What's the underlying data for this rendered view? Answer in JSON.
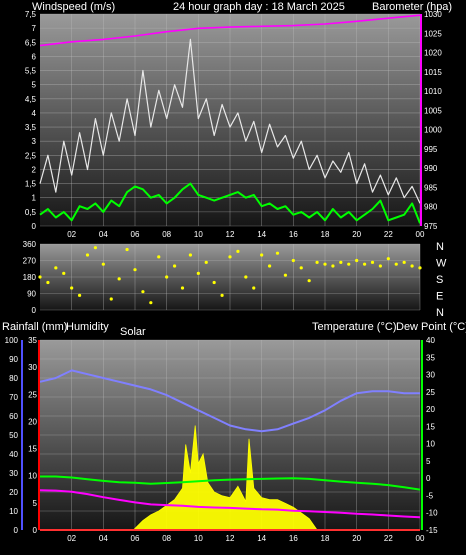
{
  "header": {
    "left_title": "Windspeed (m/s)",
    "center_title": "24 hour graph day : 18 March 2025",
    "right_title": "Barometer (hpa)"
  },
  "panel3_labels": {
    "rain": "Rainfall (mm)",
    "humidity": "Humidity",
    "solar": "Solar",
    "temperature": "Temperature (°C)",
    "dewpoint": "Dew Point (°C)"
  },
  "colors": {
    "background": "#000000",
    "plot_gradient_top": "#9a9a9a",
    "plot_gradient_bottom": "#161616",
    "wind_gust": "#e8e8e8",
    "wind_avg": "#00ff00",
    "barometer": "#ff00ff",
    "wind_dir": "#ffff00",
    "humidity_temp": "#8080ff",
    "rain": "#ff3030",
    "solar": "#ffff00",
    "temperature": "#00ff00",
    "dewpoint": "#ff00ff",
    "humidity_axis": "#5050ff",
    "rain_axis": "#ff0000"
  },
  "chart_data": [
    {
      "type": "line",
      "panel": "wind_barometer",
      "x_unit": "hour",
      "xlim": [
        0,
        24
      ],
      "x_ticks": [
        "02",
        "04",
        "06",
        "08",
        "10",
        "12",
        "14",
        "16",
        "18",
        "20",
        "22",
        "00"
      ],
      "left_axis": {
        "label": "Windspeed (m/s)",
        "ylim": [
          0,
          7.5
        ],
        "ticks": [
          "0",
          "0,5",
          "1",
          "1,5",
          "2",
          "2,5",
          "3",
          "3,5",
          "4",
          "4,5",
          "5",
          "5,5",
          "6",
          "6,5",
          "7",
          "7,5"
        ]
      },
      "right_axis": {
        "label": "Barometer (hpa)",
        "ylim": [
          975,
          1030
        ],
        "ticks": [
          "975",
          "980",
          "985",
          "990",
          "995",
          "1000",
          "1005",
          "1010",
          "1015",
          "1020",
          "1025",
          "1030"
        ]
      },
      "series": [
        {
          "name": "gust",
          "axis": "left",
          "x": [
            0,
            0.5,
            1,
            1.5,
            2,
            2.5,
            3,
            3.5,
            4,
            4.5,
            5,
            5.5,
            6,
            6.5,
            7,
            7.5,
            8,
            8.5,
            9,
            9.5,
            10,
            10.5,
            11,
            11.5,
            12,
            12.5,
            13,
            13.5,
            14,
            14.5,
            15,
            15.5,
            16,
            16.5,
            17,
            17.5,
            18,
            18.5,
            19,
            19.5,
            20,
            20.5,
            21,
            21.5,
            22,
            22.5,
            23,
            23.5,
            24
          ],
          "y": [
            1.5,
            2.5,
            1.2,
            3,
            1.8,
            3.3,
            2,
            3.8,
            2.5,
            4,
            3,
            4.5,
            3.2,
            5.5,
            3.5,
            4.8,
            3.8,
            5,
            4.2,
            6.6,
            3.8,
            4.5,
            3.2,
            4.3,
            3.5,
            4,
            3,
            3.7,
            2.6,
            3.6,
            2.8,
            3.2,
            2.4,
            3,
            2,
            2.5,
            1.7,
            2.3,
            1.9,
            2.6,
            1.5,
            2.2,
            1.2,
            1.8,
            1.1,
            1.7,
            1.0,
            1.4,
            0.8
          ]
        },
        {
          "name": "average",
          "axis": "left",
          "x": [
            0,
            0.5,
            1,
            1.5,
            2,
            2.5,
            3,
            3.5,
            4,
            4.5,
            5,
            5.5,
            6,
            6.5,
            7,
            7.5,
            8,
            8.5,
            9,
            9.5,
            10,
            10.5,
            11,
            11.5,
            12,
            12.5,
            13,
            13.5,
            14,
            14.5,
            15,
            15.5,
            16,
            16.5,
            17,
            17.5,
            18,
            18.5,
            19,
            19.5,
            20,
            20.5,
            21,
            21.5,
            22,
            22.5,
            23,
            23.5,
            24
          ],
          "y": [
            0.4,
            0.6,
            0.3,
            0.5,
            0.2,
            0.7,
            0.6,
            0.8,
            0.5,
            0.9,
            0.7,
            1.2,
            1.4,
            1.3,
            1.0,
            1.1,
            0.8,
            1.0,
            1.3,
            1.5,
            1.1,
            1.0,
            0.9,
            1.0,
            1.1,
            1.2,
            1.0,
            1.1,
            0.7,
            0.8,
            0.6,
            0.7,
            0.4,
            0.5,
            0.3,
            0.5,
            0.2,
            0.6,
            0.3,
            0.5,
            0.2,
            0.4,
            0.6,
            0.9,
            0.2,
            0.3,
            0.4,
            0.8,
            0.1
          ]
        },
        {
          "name": "barometer",
          "axis": "right",
          "x": [
            0,
            2,
            4,
            6,
            8,
            10,
            12,
            14,
            16,
            18,
            20,
            22,
            24
          ],
          "y": [
            1021.8,
            1022.8,
            1023.4,
            1024.3,
            1025.4,
            1026.3,
            1026.6,
            1026.8,
            1027.0,
            1027.4,
            1028.1,
            1028.9,
            1029.7
          ]
        }
      ]
    },
    {
      "type": "scatter",
      "panel": "wind_direction",
      "x_unit": "hour",
      "xlim": [
        0,
        24
      ],
      "left_axis": {
        "ylim": [
          0,
          360
        ],
        "ticks": [
          "0",
          "90",
          "180",
          "270",
          "360"
        ]
      },
      "right_labels": [
        "N",
        "W",
        "S",
        "E",
        "N"
      ],
      "series": [
        {
          "name": "direction",
          "x": [
            0,
            0.5,
            1,
            1.5,
            2,
            2.5,
            3,
            3.5,
            4,
            4.5,
            5,
            5.5,
            6,
            6.5,
            7,
            7.5,
            8,
            8.5,
            9,
            9.5,
            10,
            10.5,
            11,
            11.5,
            12,
            12.5,
            13,
            13.5,
            14,
            14.5,
            15,
            15.5,
            16,
            16.5,
            17,
            17.5,
            18,
            18.5,
            19,
            19.5,
            20,
            20.5,
            21,
            21.5,
            22,
            22.5,
            23,
            23.5,
            24
          ],
          "y": [
            180,
            150,
            230,
            200,
            120,
            80,
            300,
            340,
            250,
            60,
            170,
            330,
            220,
            100,
            40,
            290,
            180,
            240,
            120,
            300,
            200,
            260,
            150,
            80,
            290,
            320,
            180,
            120,
            300,
            240,
            310,
            190,
            270,
            230,
            160,
            260,
            250,
            240,
            260,
            250,
            270,
            250,
            260,
            240,
            280,
            250,
            260,
            240,
            230
          ]
        }
      ]
    },
    {
      "type": "line",
      "panel": "temperature_humidity",
      "x_unit": "hour",
      "xlim": [
        0,
        24
      ],
      "x_ticks": [
        "02",
        "04",
        "06",
        "08",
        "10",
        "12",
        "14",
        "16",
        "18",
        "20",
        "22",
        "00"
      ],
      "humidity_axis": {
        "label": "Humidity",
        "ylim": [
          0,
          100
        ],
        "ticks": [
          "0",
          "10",
          "20",
          "30",
          "40",
          "50",
          "60",
          "70",
          "80",
          "90",
          "100"
        ]
      },
      "rain_axis": {
        "label": "Rainfall (mm)",
        "ylim": [
          0,
          35
        ],
        "ticks": [
          "0",
          "5",
          "10",
          "15",
          "20",
          "25",
          "30",
          "35"
        ]
      },
      "temp_axis": {
        "label": "Temperature (°C)",
        "ylim": [
          -15,
          40
        ],
        "ticks": [
          "-15",
          "-10",
          "-5",
          "0",
          "5",
          "10",
          "15",
          "20",
          "25",
          "30",
          "35",
          "40"
        ]
      },
      "series": [
        {
          "name": "humidity",
          "axis": "humidity",
          "x": [
            0,
            1,
            2,
            3,
            4,
            5,
            6,
            7,
            8,
            9,
            10,
            11,
            12,
            13,
            14,
            15,
            16,
            17,
            18,
            19,
            20,
            21,
            22,
            23,
            24
          ],
          "y": [
            78,
            80,
            84,
            82,
            80,
            78,
            76,
            74,
            71,
            67,
            63,
            59,
            55,
            53,
            52,
            53,
            56,
            59,
            63,
            68,
            72,
            73,
            73,
            72,
            72
          ]
        },
        {
          "name": "rainfall",
          "axis": "rain",
          "x": [
            0,
            24
          ],
          "y": [
            0,
            0
          ]
        },
        {
          "name": "solar",
          "axis": "humidity",
          "x": [
            5.9,
            6.5,
            7,
            7.5,
            8,
            8.5,
            9,
            9.2,
            9.5,
            9.8,
            10,
            10.3,
            10.6,
            11,
            11.5,
            12,
            12.5,
            13,
            13.2,
            13.5,
            14,
            14.5,
            15,
            15.5,
            16,
            16.5,
            17,
            17.5
          ],
          "y": [
            0,
            5,
            8,
            10,
            13,
            16,
            22,
            45,
            30,
            55,
            35,
            40,
            25,
            20,
            18,
            17,
            23,
            15,
            48,
            22,
            17,
            16,
            16,
            14,
            12,
            9,
            6,
            0
          ]
        },
        {
          "name": "temperature",
          "axis": "temp",
          "x": [
            0,
            1,
            2,
            3,
            4,
            5,
            6,
            7,
            8,
            9,
            10,
            11,
            12,
            13,
            14,
            15,
            16,
            17,
            18,
            19,
            20,
            21,
            22,
            23,
            24
          ],
          "y": [
            0.5,
            0.5,
            0.2,
            -0.3,
            -0.8,
            -1.2,
            -1.3,
            -1.6,
            -1.4,
            -1.2,
            -0.9,
            -0.6,
            -0.4,
            -0.3,
            -0.2,
            -0.1,
            0,
            -0.2,
            -0.6,
            -1,
            -1.3,
            -1.6,
            -2,
            -2.6,
            -3.3
          ]
        },
        {
          "name": "dewpoint",
          "axis": "temp",
          "x": [
            0,
            1,
            2,
            3,
            4,
            5,
            6,
            7,
            8,
            9,
            10,
            11,
            12,
            13,
            14,
            15,
            16,
            17,
            18,
            19,
            20,
            21,
            22,
            23,
            24
          ],
          "y": [
            -3.5,
            -3.6,
            -3.9,
            -4.6,
            -5.5,
            -6.3,
            -7,
            -7.6,
            -7.8,
            -8,
            -8.3,
            -8.5,
            -8.6,
            -8.8,
            -9,
            -9.1,
            -9.4,
            -9.6,
            -9.8,
            -10,
            -10.3,
            -10.5,
            -10.8,
            -11.1,
            -11.3
          ]
        }
      ]
    }
  ]
}
